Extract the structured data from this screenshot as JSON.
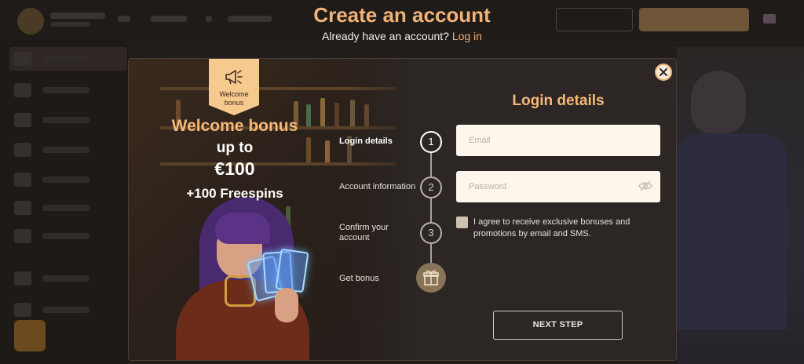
{
  "page": {
    "title": "Create an account",
    "subtitle_prefix": "Already have an account?",
    "login_link": "Log in"
  },
  "promo": {
    "ribbon_label": "Welcome bonus",
    "title": "Welcome bonus",
    "up_to": "up to",
    "amount": "€100",
    "freespins": "+100 Freespins",
    "ribbon_icon": "megaphone-icon"
  },
  "steps": [
    {
      "label": "Login details",
      "number": "1",
      "active": true
    },
    {
      "label": "Account information",
      "number": "2",
      "active": false
    },
    {
      "label": "Confirm your account",
      "number": "3",
      "active": false
    },
    {
      "label": "Get bonus",
      "icon": "gift-icon"
    }
  ],
  "form": {
    "title": "Login details",
    "email_placeholder": "Email",
    "password_placeholder": "Password",
    "consent_text": "I agree to receive exclusive bonuses and promotions by email and SMS.",
    "next_button": "NEXT STEP",
    "close_icon": "close-icon",
    "eye_icon": "eye-off-icon"
  },
  "colors": {
    "accent": "#f2b277",
    "modal_bg": "#2c2725",
    "field_bg": "#fdf6ec"
  }
}
